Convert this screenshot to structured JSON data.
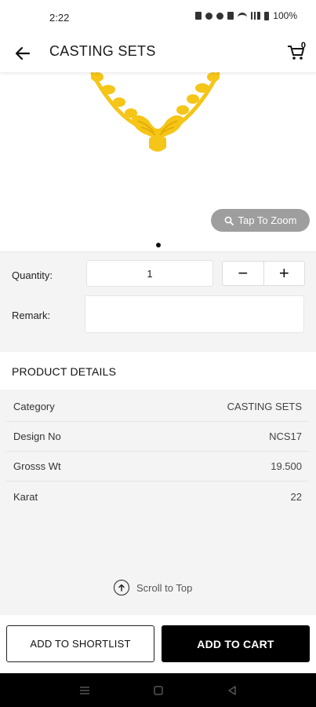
{
  "status_bar": {
    "time": "2:22",
    "battery": "100%"
  },
  "header": {
    "title": "CASTING SETS",
    "cart_count": "0"
  },
  "product_image": {
    "zoom_label": "Tap To Zoom"
  },
  "form": {
    "quantity_label": "Quantity:",
    "quantity_value": "1",
    "decrement_symbol": "−",
    "increment_symbol": "+",
    "remark_label": "Remark:",
    "remark_value": ""
  },
  "details": {
    "title": "PRODUCT DETAILS",
    "rows": [
      {
        "label": "Category",
        "value": "CASTING SETS"
      },
      {
        "label": "Design No",
        "value": "NCS17"
      },
      {
        "label": "Grosss Wt",
        "value": "19.500"
      },
      {
        "label": "Karat",
        "value": "22"
      }
    ]
  },
  "scroll_to_top_label": "Scroll to Top",
  "actions": {
    "shortlist_label": "ADD TO SHORTLIST",
    "cart_label": "ADD TO CART"
  },
  "colors": {
    "gold": "#F5C518",
    "gold_dark": "#E0A800",
    "accent": "#000000",
    "panel_bg": "#f4f4f4"
  }
}
